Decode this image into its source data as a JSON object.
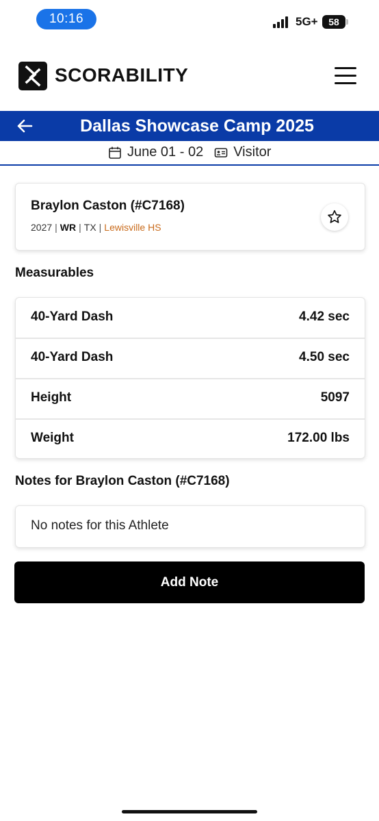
{
  "status_bar": {
    "time": "10:16",
    "network": "5G+",
    "battery": "58"
  },
  "header": {
    "brand": "SCORABILITY"
  },
  "event": {
    "title": "Dallas Showcase Camp 2025",
    "dates": "June 01 - 02",
    "role": "Visitor"
  },
  "athlete": {
    "name": "Braylon Caston (#C7168)",
    "class_year": "2027",
    "position": "WR",
    "state": "TX",
    "school": "Lewisville HS"
  },
  "measurables": {
    "title": "Measurables",
    "rows": [
      {
        "label": "40-Yard Dash",
        "value": "4.42 sec"
      },
      {
        "label": "40-Yard Dash",
        "value": "4.50 sec"
      },
      {
        "label": "Height",
        "value": "5097"
      },
      {
        "label": "Weight",
        "value": "172.00 lbs"
      }
    ]
  },
  "notes": {
    "title": "Notes for Braylon Caston (#C7168)",
    "empty_text": "No notes for this Athlete",
    "add_label": "Add Note"
  },
  "colors": {
    "event_bar": "#0a3ba7",
    "time_pill": "#1a73e8",
    "school_link": "#c96a1a"
  }
}
